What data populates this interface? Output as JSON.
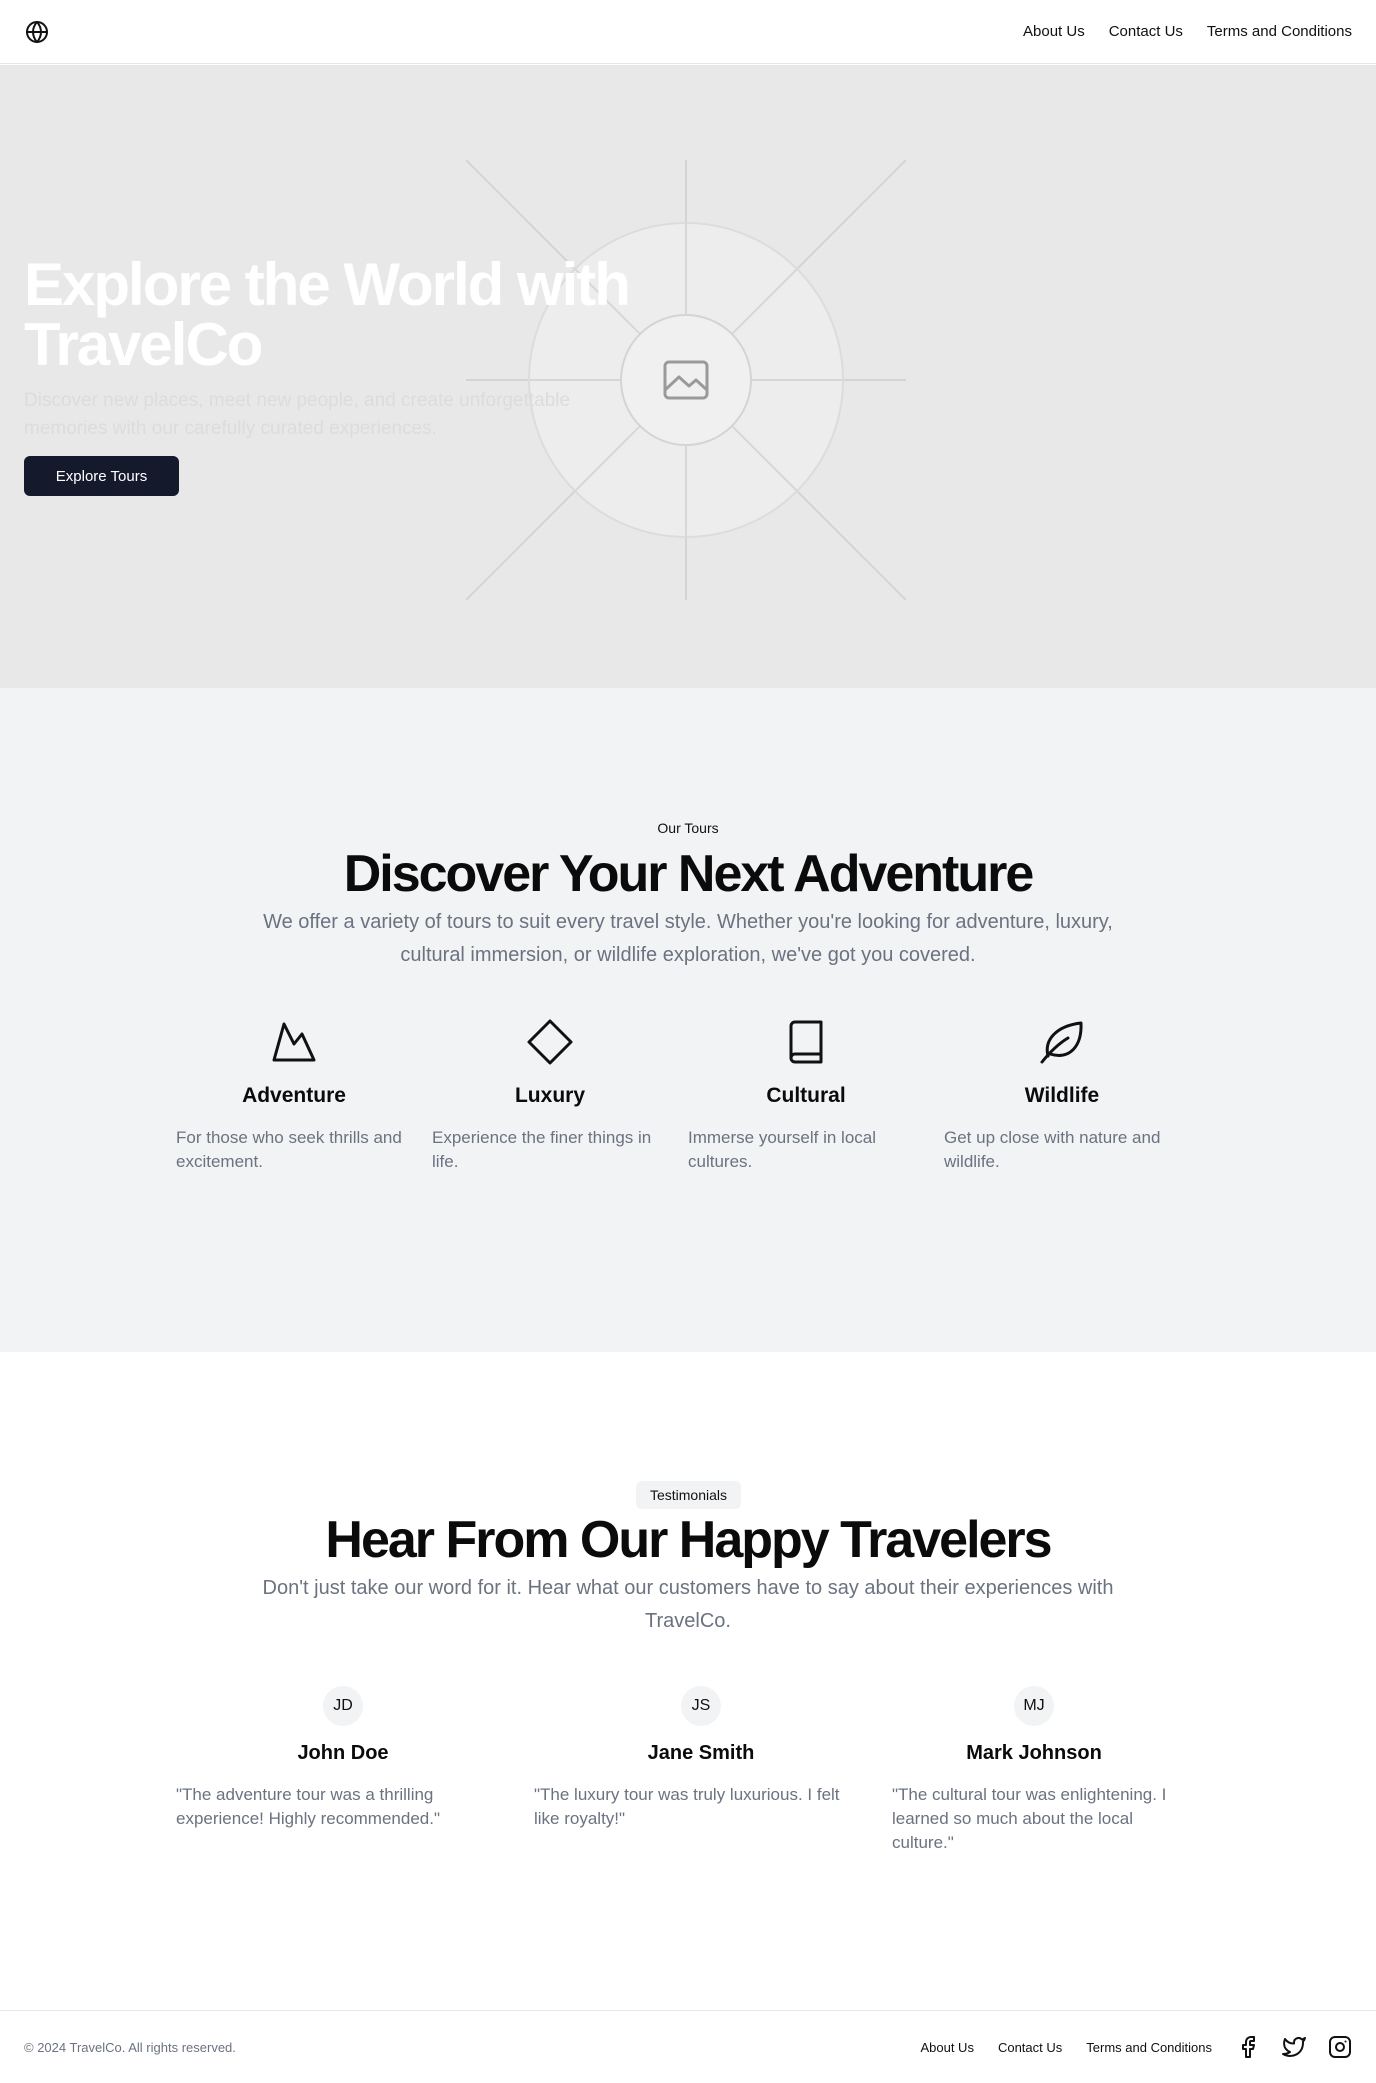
{
  "header": {
    "logo_icon": "globe-icon",
    "nav": [
      "About Us",
      "Contact Us",
      "Terms and Conditions"
    ]
  },
  "hero": {
    "title": "Explore the World with TravelCo",
    "subtitle": "Discover new places, meet new people, and create unforgettable memories with our carefully curated experiences.",
    "button_label": "Explore Tours",
    "image_icon": "image-placeholder-icon"
  },
  "tours": {
    "eyebrow": "Our Tours",
    "title": "Discover Your Next Adventure",
    "description": "We offer a variety of tours to suit every travel style. Whether you're looking for adventure, luxury, cultural immersion, or wildlife exploration, we've got you covered.",
    "items": [
      {
        "icon": "mountain-icon",
        "name": "Adventure",
        "description": "For those who seek thrills and excitement."
      },
      {
        "icon": "diamond-icon",
        "name": "Luxury",
        "description": "Experience the finer things in life."
      },
      {
        "icon": "book-icon",
        "name": "Cultural",
        "description": "Immerse yourself in local cultures."
      },
      {
        "icon": "leaf-icon",
        "name": "Wildlife",
        "description": "Get up close with nature and wildlife."
      }
    ]
  },
  "testimonials": {
    "pill": "Testimonials",
    "title": "Hear From Our Happy Travelers",
    "description": "Don't just take our word for it. Hear what our customers have to say about their experiences with TravelCo.",
    "items": [
      {
        "initials": "JD",
        "name": "John Doe",
        "quote": "\"The adventure tour was a thrilling experience! Highly recommended.\""
      },
      {
        "initials": "JS",
        "name": "Jane Smith",
        "quote": "\"The luxury tour was truly luxurious. I felt like royalty!\""
      },
      {
        "initials": "MJ",
        "name": "Mark Johnson",
        "quote": "\"The cultural tour was enlightening. I learned so much about the local culture.\""
      }
    ]
  },
  "footer": {
    "copyright": "© 2024 TravelCo. All rights reserved.",
    "nav": [
      "About Us",
      "Contact Us",
      "Terms and Conditions"
    ],
    "social": [
      "facebook-icon",
      "twitter-icon",
      "instagram-icon"
    ]
  }
}
